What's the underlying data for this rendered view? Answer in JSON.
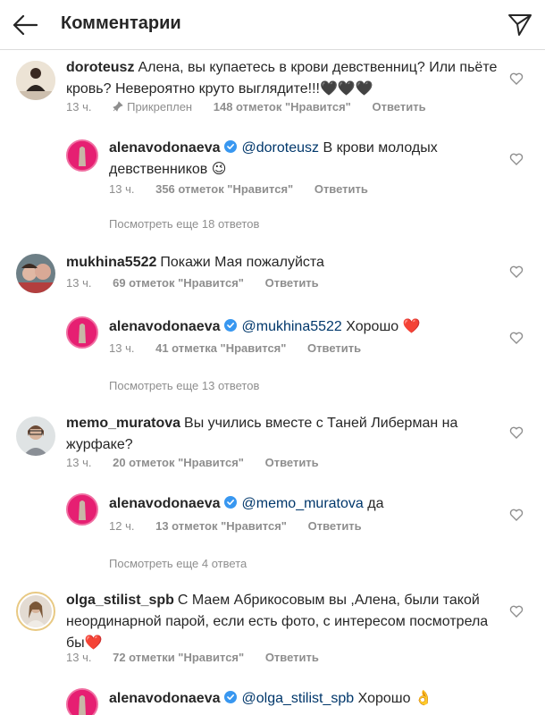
{
  "header": {
    "title": "Комментарии",
    "back_icon": "arrow-left-icon",
    "send_icon": "paper-plane-icon"
  },
  "threads": [
    {
      "comment": {
        "user": "doroteusz",
        "text": "Алена, вы купаетесь в крови девственниц? Или пьёте кровь? Невероятно круто выглядите!!!🖤🖤🖤",
        "time": "13 ч.",
        "pinned": "Прикреплен",
        "likes": "148 отметок \"Нравится\"",
        "reply": "Ответить"
      },
      "reply": {
        "user": "alenavodonaeva",
        "mention": "@doroteusz",
        "text": "В крови молодых девственников 😉",
        "time": "13 ч.",
        "likes": "356 отметок \"Нравится\"",
        "reply": "Ответить"
      },
      "view_more": "Посмотреть еще 18 ответов"
    },
    {
      "comment": {
        "user": "mukhina5522",
        "text": "Покажи Мая пожалуйста",
        "time": "13 ч.",
        "likes": "69 отметок \"Нравится\"",
        "reply": "Ответить"
      },
      "reply": {
        "user": "alenavodonaeva",
        "mention": "@mukhina5522",
        "text": "Хорошо ❤️",
        "time": "13 ч.",
        "likes": "41 отметка \"Нравится\"",
        "reply": "Ответить"
      },
      "view_more": "Посмотреть еще 13 ответов"
    },
    {
      "comment": {
        "user": "memo_muratova",
        "text": "Вы учились вместе с Таней Либерман на журфаке?",
        "time": "13 ч.",
        "likes": "20 отметок \"Нравится\"",
        "reply": "Ответить"
      },
      "reply": {
        "user": "alenavodonaeva",
        "mention": "@memo_muratova",
        "text": "да",
        "time": "12 ч.",
        "likes": "13 отметок \"Нравится\"",
        "reply": "Ответить"
      },
      "view_more": "Посмотреть еще 4 ответа"
    },
    {
      "comment": {
        "user": "olga_stilist_spb",
        "text": "С Маем Абрикосовым вы ,Алена, были такой неординарной парой, если есть фото, с интересом посмотрела бы❤️",
        "time": "13 ч.",
        "likes": "72 отметки \"Нравится\"",
        "reply": "Ответить"
      },
      "reply": {
        "user": "alenavodonaeva",
        "mention": "@olga_stilist_spb",
        "text": "Хорошо 👌"
      }
    }
  ],
  "colors": {
    "meta": "#8e8e8e",
    "mention": "#00376b",
    "verified": "#3897f0",
    "brand_pink": "#e61f72"
  }
}
